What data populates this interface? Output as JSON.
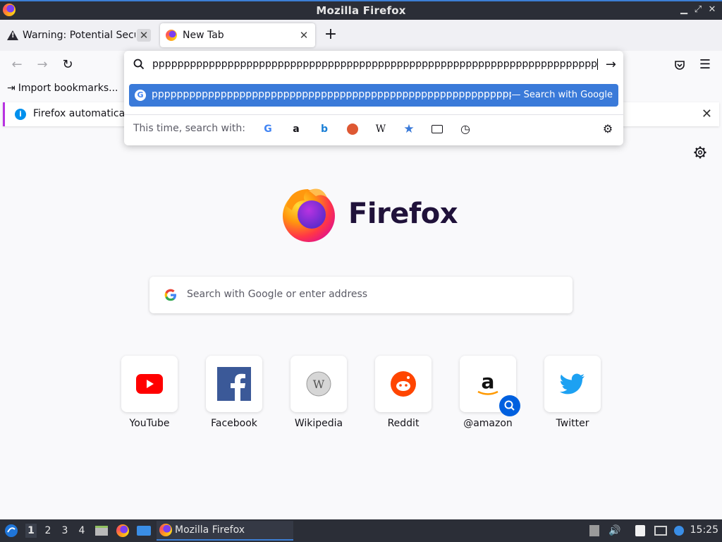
{
  "window": {
    "title": "Mozilla Firefox",
    "controls": [
      "minimize-icon",
      "maximize-icon",
      "close-icon"
    ]
  },
  "tabs": [
    {
      "label": "Warning: Potential Security Risk Ahead",
      "icon": "warning-icon",
      "active": false
    },
    {
      "label": "New Tab",
      "icon": "firefox-icon",
      "active": true
    }
  ],
  "urlbar": {
    "value": "pppppppppppppppppppppppppppppppppppppppppppppppppppppppppppppppppppppppppp",
    "suggestion": {
      "text": "pppppppppppppppppppppppppppppppppppppppppppppppppppppppppppppppppppppppppp",
      "action": "— Search with Google"
    },
    "oneoff_label": "This time, search with:",
    "oneoff_engines": [
      "google-icon",
      "amazon-icon",
      "bing-icon",
      "duckduckgo-icon",
      "wikipedia-icon",
      "bookmarks-icon",
      "tabs-icon",
      "history-icon"
    ]
  },
  "bookmarks": {
    "import_label": "Import bookmarks..."
  },
  "notification": {
    "text": "Firefox automaticall"
  },
  "page": {
    "logo_text": "Firefox",
    "search_placeholder": "Search with Google or enter address",
    "top_sites": [
      {
        "name": "YouTube",
        "icon": "youtube-icon"
      },
      {
        "name": "Facebook",
        "icon": "facebook-icon"
      },
      {
        "name": "Wikipedia",
        "icon": "wikipedia-icon"
      },
      {
        "name": "Reddit",
        "icon": "reddit-icon"
      },
      {
        "name": "@amazon",
        "icon": "amazon-icon"
      },
      {
        "name": "Twitter",
        "icon": "twitter-icon"
      }
    ]
  },
  "taskbar": {
    "workspaces": [
      "1",
      "2",
      "3",
      "4"
    ],
    "window_label": "Mozilla Firefox",
    "clock": "15:25"
  },
  "colors": {
    "accent": "#3a7ad9",
    "titlebar": "#2b2e37",
    "page_bg": "#f9f9fb"
  }
}
